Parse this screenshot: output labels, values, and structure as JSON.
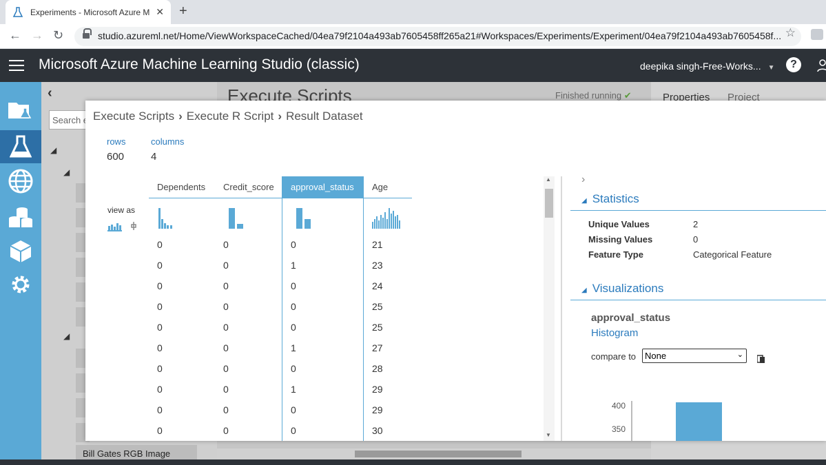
{
  "browser": {
    "tab_title": "Experiments - Microsoft Azure M",
    "tab_close": "✕",
    "new_tab": "+",
    "url": "studio.azureml.net/Home/ViewWorkspaceCached/04ea79f2104a493ab7605458ff265a21#Workspaces/Experiments/Experiment/04ea79f2104a493ab7605458f..."
  },
  "app": {
    "title": "Microsoft Azure Machine Learning Studio (classic)",
    "user": "deepika singh-Free-Works...",
    "help": "?"
  },
  "background": {
    "experiment_title": "Execute Scripts",
    "status": "Finished running",
    "properties_tab": "Properties",
    "project_tab": "Project",
    "search_placeholder": "Search e",
    "saved_item": "Bill Gates RGB Image"
  },
  "modal": {
    "breadcrumb": [
      "Execute Scripts",
      "Execute R Script",
      "Result Dataset"
    ],
    "rows_label": "rows",
    "rows_value": "600",
    "columns_label": "columns",
    "columns_value": "4",
    "view_as": "view as",
    "columns": [
      {
        "name": "Dependents",
        "values": [
          "0",
          "0",
          "0",
          "0",
          "0",
          "0",
          "0",
          "0",
          "0",
          "0"
        ]
      },
      {
        "name": "Credit_score",
        "values": [
          "0",
          "0",
          "0",
          "0",
          "0",
          "0",
          "0",
          "0",
          "0",
          "0"
        ]
      },
      {
        "name": "approval_status",
        "values": [
          "0",
          "1",
          "0",
          "0",
          "0",
          "1",
          "0",
          "1",
          "0",
          "0"
        ]
      },
      {
        "name": "Age",
        "values": [
          "21",
          "23",
          "24",
          "25",
          "25",
          "27",
          "28",
          "29",
          "29",
          "30"
        ]
      }
    ],
    "statistics": {
      "title": "Statistics",
      "rows": [
        {
          "k": "Unique Values",
          "v": "2"
        },
        {
          "k": "Missing Values",
          "v": "0"
        },
        {
          "k": "Feature Type",
          "v": "Categorical Feature"
        }
      ]
    },
    "visualizations": {
      "title": "Visualizations",
      "feature": "approval_status",
      "chart_link": "Histogram",
      "compare_label": "compare to",
      "compare_value": "None",
      "y_ticks": [
        "400",
        "350"
      ]
    }
  },
  "colors": {
    "accent": "#5aa9d6",
    "appbar": "#2d3238",
    "link": "#2b7bbd"
  }
}
